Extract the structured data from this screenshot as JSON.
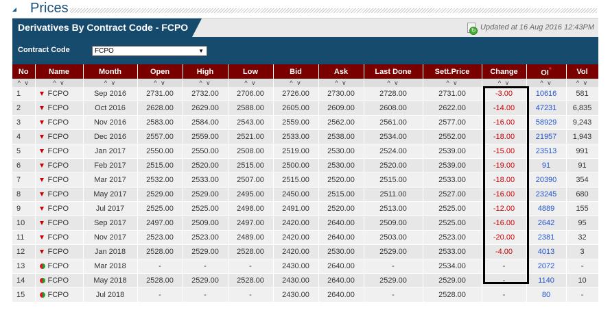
{
  "page": {
    "title": "Prices"
  },
  "panel": {
    "tab_title": "Derivatives By Contract Code - FCPO",
    "updated": "Updated at 16 Aug 2016 12:43PM"
  },
  "filter": {
    "label": "Contract Code",
    "selected": "FCPO"
  },
  "table": {
    "columns": [
      "No",
      "Name",
      "Month",
      "Open",
      "High",
      "Low",
      "Bid",
      "Ask",
      "Last Done",
      "Sett.Price",
      "Change",
      "OI",
      "Vol"
    ],
    "sort_glyph": "^ v",
    "rows": [
      {
        "no": "1",
        "name": "FCPO",
        "trend": "down",
        "month": "Sep 2016",
        "open": "2731.00",
        "high": "2732.00",
        "low": "2706.00",
        "bid": "2726.00",
        "ask": "2730.00",
        "last": "2728.00",
        "sett": "2731.00",
        "change": "-3.00",
        "oi": "10616",
        "vol": "581"
      },
      {
        "no": "2",
        "name": "FCPO",
        "trend": "down",
        "month": "Oct 2016",
        "open": "2628.00",
        "high": "2629.00",
        "low": "2588.00",
        "bid": "2605.00",
        "ask": "2609.00",
        "last": "2608.00",
        "sett": "2622.00",
        "change": "-14.00",
        "oi": "47231",
        "vol": "6,835"
      },
      {
        "no": "3",
        "name": "FCPO",
        "trend": "down",
        "month": "Nov 2016",
        "open": "2583.00",
        "high": "2584.00",
        "low": "2543.00",
        "bid": "2559.00",
        "ask": "2562.00",
        "last": "2561.00",
        "sett": "2577.00",
        "change": "-16.00",
        "oi": "58929",
        "vol": "9,243"
      },
      {
        "no": "4",
        "name": "FCPO",
        "trend": "down",
        "month": "Dec 2016",
        "open": "2557.00",
        "high": "2559.00",
        "low": "2521.00",
        "bid": "2533.00",
        "ask": "2538.00",
        "last": "2534.00",
        "sett": "2552.00",
        "change": "-18.00",
        "oi": "21957",
        "vol": "1,943"
      },
      {
        "no": "5",
        "name": "FCPO",
        "trend": "down",
        "month": "Jan 2017",
        "open": "2550.00",
        "high": "2550.00",
        "low": "2508.00",
        "bid": "2519.00",
        "ask": "2530.00",
        "last": "2524.00",
        "sett": "2539.00",
        "change": "-15.00",
        "oi": "23513",
        "vol": "991"
      },
      {
        "no": "6",
        "name": "FCPO",
        "trend": "down",
        "month": "Feb 2017",
        "open": "2515.00",
        "high": "2520.00",
        "low": "2515.00",
        "bid": "2500.00",
        "ask": "2530.00",
        "last": "2520.00",
        "sett": "2539.00",
        "change": "-19.00",
        "oi": "91",
        "vol": "91"
      },
      {
        "no": "7",
        "name": "FCPO",
        "trend": "down",
        "month": "Mar 2017",
        "open": "2532.00",
        "high": "2533.00",
        "low": "2507.00",
        "bid": "2515.00",
        "ask": "2520.00",
        "last": "2515.00",
        "sett": "2533.00",
        "change": "-18.00",
        "oi": "20390",
        "vol": "354"
      },
      {
        "no": "8",
        "name": "FCPO",
        "trend": "down",
        "month": "May 2017",
        "open": "2529.00",
        "high": "2529.00",
        "low": "2495.00",
        "bid": "2450.00",
        "ask": "2515.00",
        "last": "2511.00",
        "sett": "2527.00",
        "change": "-16.00",
        "oi": "23245",
        "vol": "680"
      },
      {
        "no": "9",
        "name": "FCPO",
        "trend": "down",
        "month": "Jul 2017",
        "open": "2525.00",
        "high": "2525.00",
        "low": "2498.00",
        "bid": "2491.00",
        "ask": "2520.00",
        "last": "2513.00",
        "sett": "2525.00",
        "change": "-12.00",
        "oi": "4889",
        "vol": "155"
      },
      {
        "no": "10",
        "name": "FCPO",
        "trend": "down",
        "month": "Sep 2017",
        "open": "2497.00",
        "high": "2509.00",
        "low": "2497.00",
        "bid": "2420.00",
        "ask": "2640.00",
        "last": "2509.00",
        "sett": "2525.00",
        "change": "-16.00",
        "oi": "2642",
        "vol": "95"
      },
      {
        "no": "11",
        "name": "FCPO",
        "trend": "down",
        "month": "Nov 2017",
        "open": "2523.00",
        "high": "2523.00",
        "low": "2489.00",
        "bid": "2420.00",
        "ask": "2640.00",
        "last": "2503.00",
        "sett": "2523.00",
        "change": "-20.00",
        "oi": "2381",
        "vol": "32"
      },
      {
        "no": "12",
        "name": "FCPO",
        "trend": "down",
        "month": "Jan 2018",
        "open": "2528.00",
        "high": "2529.00",
        "low": "2528.00",
        "bid": "2420.00",
        "ask": "2530.00",
        "last": "2529.00",
        "sett": "2533.00",
        "change": "-4.00",
        "oi": "4013",
        "vol": "3"
      },
      {
        "no": "13",
        "name": "FCPO",
        "trend": "flat",
        "month": "Mar 2018",
        "open": "-",
        "high": "-",
        "low": "-",
        "bid": "2430.00",
        "ask": "2640.00",
        "last": "-",
        "sett": "2534.00",
        "change": "-",
        "oi": "2072",
        "vol": "-"
      },
      {
        "no": "14",
        "name": "FCPO",
        "trend": "flat",
        "month": "May 2018",
        "open": "2528.00",
        "high": "2529.00",
        "low": "2528.00",
        "bid": "2430.00",
        "ask": "2640.00",
        "last": "2529.00",
        "sett": "2529.00",
        "change": "-",
        "oi": "1140",
        "vol": "10"
      },
      {
        "no": "15",
        "name": "FCPO",
        "trend": "flat",
        "month": "Jul 2018",
        "open": "-",
        "high": "-",
        "low": "-",
        "bid": "2430.00",
        "ask": "2640.00",
        "last": "-",
        "sett": "2528.00",
        "change": "-",
        "oi": "80",
        "vol": "-"
      }
    ]
  },
  "colors": {
    "header_red": "#7a0000",
    "panel_blue": "#164a6d",
    "change_red": "#cc0000",
    "link_blue": "#2255cc"
  }
}
